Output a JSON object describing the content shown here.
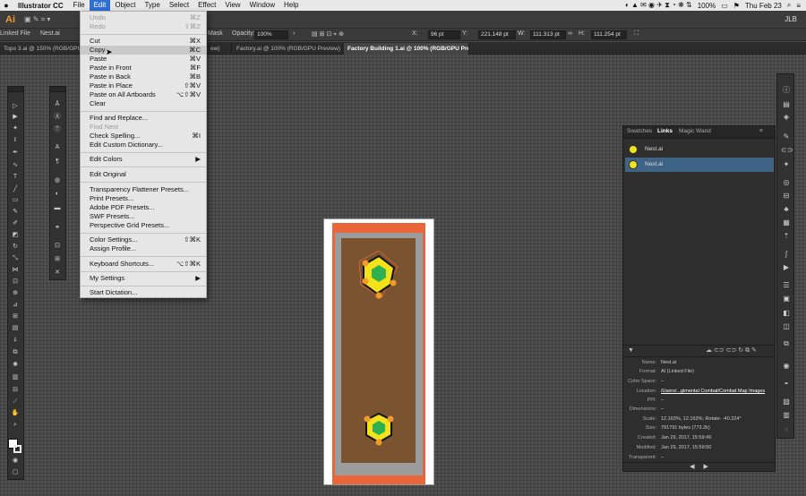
{
  "menubar": {
    "apple": "",
    "app_name": "Illustrator CC",
    "items": [
      "File",
      "Edit",
      "Object",
      "Type",
      "Select",
      "Effect",
      "View",
      "Window",
      "Help"
    ],
    "active_item": "Edit",
    "battery": "100%",
    "clock": "Thu Feb 23"
  },
  "appbar": {
    "logo": "Ai",
    "user": "JLB"
  },
  "controlbar": {
    "linked_file": "Linked File",
    "file_name": "Nest.ai",
    "mask_label": "Mask",
    "opacity_label": "Opacity:",
    "opacity_value": "100%",
    "x_label": "X:",
    "x_value": "96 pt",
    "y_label": "Y:",
    "y_value": "221.148 pt",
    "w_label": "W:",
    "w_value": "111.313 pt",
    "h_label": "H:",
    "h_value": "111.254 pt"
  },
  "tabs": [
    {
      "label": "Topo 3.ai @ 150% (RGB/GPU Preview)",
      "active": false
    },
    {
      "label": "Factory.ai @ 100% (RGB/GPU Preview)",
      "active": false
    },
    {
      "label": "Factory Building 1.ai @ 100% (RGB/GPU Preview)",
      "active": true
    }
  ],
  "tab_fragment": "ew)",
  "edit_menu": {
    "groups": [
      [
        {
          "label": "Undo",
          "shortcut": "⌘Z",
          "disabled": true
        },
        {
          "label": "Redo",
          "shortcut": "⇧⌘Z",
          "disabled": true
        }
      ],
      [
        {
          "label": "Cut",
          "shortcut": "⌘X"
        },
        {
          "label": "Copy",
          "shortcut": "⌘C",
          "highlighted": true
        },
        {
          "label": "Paste",
          "shortcut": "⌘V"
        },
        {
          "label": "Paste in Front",
          "shortcut": "⌘F"
        },
        {
          "label": "Paste in Back",
          "shortcut": "⌘B"
        },
        {
          "label": "Paste in Place",
          "shortcut": "⇧⌘V"
        },
        {
          "label": "Paste on All Artboards",
          "shortcut": "⌥⇧⌘V"
        },
        {
          "label": "Clear",
          "shortcut": ""
        }
      ],
      [
        {
          "label": "Find and Replace...",
          "shortcut": ""
        },
        {
          "label": "Find Next",
          "shortcut": "",
          "disabled": true
        },
        {
          "label": "Check Spelling...",
          "shortcut": "⌘I"
        },
        {
          "label": "Edit Custom Dictionary...",
          "shortcut": ""
        }
      ],
      [
        {
          "label": "Edit Colors",
          "shortcut": "▶"
        }
      ],
      [
        {
          "label": "Edit Original",
          "shortcut": ""
        }
      ],
      [
        {
          "label": "Transparency Flattener Presets...",
          "shortcut": ""
        },
        {
          "label": "Print Presets...",
          "shortcut": ""
        },
        {
          "label": "Adobe PDF Presets...",
          "shortcut": ""
        },
        {
          "label": "SWF Presets...",
          "shortcut": ""
        },
        {
          "label": "Perspective Grid Presets...",
          "shortcut": ""
        }
      ],
      [
        {
          "label": "Color Settings...",
          "shortcut": "⇧⌘K"
        },
        {
          "label": "Assign Profile...",
          "shortcut": ""
        }
      ],
      [
        {
          "label": "Keyboard Shortcuts...",
          "shortcut": "⌥⇧⌘K"
        }
      ],
      [
        {
          "label": "My Settings",
          "shortcut": "▶"
        }
      ],
      [
        {
          "label": "Start Dictation...",
          "shortcut": ""
        }
      ]
    ]
  },
  "links_panel": {
    "tabs": [
      "Swatches",
      "Links",
      "Magic Wand"
    ],
    "active_tab": "Links",
    "items": [
      {
        "name": "Nest.ai",
        "selected": false
      },
      {
        "name": "Nest.ai",
        "selected": true
      }
    ],
    "info": [
      {
        "key": "Name:",
        "value": "Nest.ai"
      },
      {
        "key": "Format:",
        "value": "AI (Linked File)"
      },
      {
        "key": "Color Space:",
        "value": "–"
      },
      {
        "key": "Location:",
        "value": "/Users/...gimental Combat/Combat Map Images"
      },
      {
        "key": "PPI:",
        "value": "–"
      },
      {
        "key": "Dimensions:",
        "value": "–"
      },
      {
        "key": "Scale:",
        "value": "12.163%, 12.163%; Rotate: -40.324°"
      },
      {
        "key": "Size:",
        "value": "791791 bytes (773.2k)"
      },
      {
        "key": "Created:",
        "value": "Jan 29, 2017, 15:59:49"
      },
      {
        "key": "Modified:",
        "value": "Jan 29, 2017, 15:59:50"
      },
      {
        "key": "Transparent:",
        "value": "–"
      }
    ]
  },
  "colors": {
    "menu_highlight": "#2f6fd6",
    "link_selected": "#3f6384",
    "artboard_orange": "#e8663a",
    "artboard_gray": "#9c9c9c",
    "artboard_brown": "#7a5330",
    "nest_yellow": "#f3e21a",
    "nest_green": "#2db04f"
  }
}
